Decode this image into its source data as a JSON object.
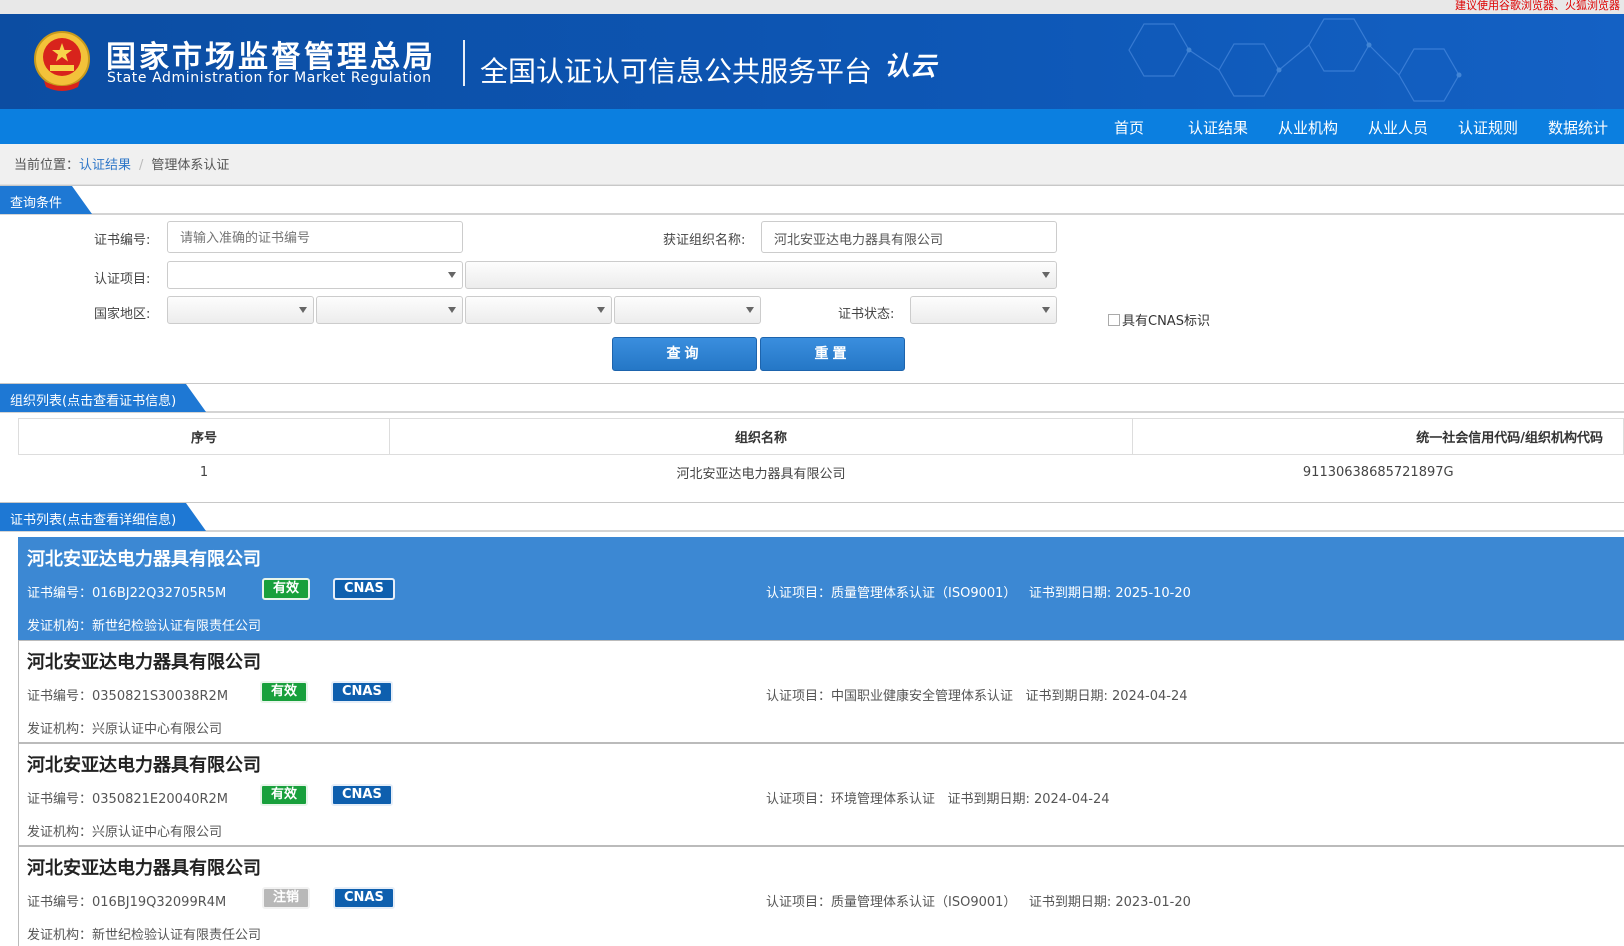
{
  "browser_notice": "建议使用谷歌浏览器、火狐浏览器",
  "header": {
    "org_cn": "国家市场监督管理总局",
    "org_en": "State Administration  for  Market Regulation",
    "platform": "全国认证认可信息公共服务平台",
    "brand": "认云"
  },
  "nav": [
    "首页",
    "认证结果",
    "从业机构",
    "从业人员",
    "认证规则",
    "数据统计"
  ],
  "breadcrumb": {
    "prefix": "当前位置：",
    "level1": "认证结果",
    "separator": "/",
    "level2": "管理体系认证"
  },
  "query": {
    "section_title": "查询条件",
    "cert_no_label": "证书编号:",
    "cert_no_placeholder": "请输入准确的证书编号",
    "org_name_label": "获证组织名称:",
    "org_name_value": "河北安亚达电力器具有限公司",
    "cert_item_label": "认证项目:",
    "region_label": "国家地区:",
    "status_label": "证书状态:",
    "cnas_label": "具有CNAS标识",
    "search_button": "查询",
    "reset_button": "重置"
  },
  "org_list": {
    "section_title": "组织列表(点击查看证书信息)",
    "columns": [
      "序号",
      "组织名称",
      "统一社会信用代码/组织机构代码"
    ],
    "rows": [
      [
        "1",
        "河北安亚达电力器具有限公司",
        "91130638685721897G"
      ]
    ]
  },
  "cert_list": {
    "section_title": "证书列表(点击查看详细信息)",
    "cert_no_prefix": "证书编号：",
    "issuer_prefix": "发证机构：",
    "item_prefix": "认证项目：",
    "expiry_prefix": "证书到期日期:",
    "cnas_badge": "CNAS",
    "items": [
      {
        "name": "河北安亚达电力器具有限公司",
        "cert_no": "016BJ22Q32705R5M",
        "status": "有效",
        "item": "质量管理体系认证（ISO9001）",
        "expiry": "2025-10-20",
        "issuer": "新世纪检验认证有限责任公司"
      },
      {
        "name": "河北安亚达电力器具有限公司",
        "cert_no": "0350821S30038R2M",
        "status": "有效",
        "item": "中国职业健康安全管理体系认证",
        "expiry": "2024-04-24",
        "issuer": "兴原认证中心有限公司"
      },
      {
        "name": "河北安亚达电力器具有限公司",
        "cert_no": "0350821E20040R2M",
        "status": "有效",
        "item": "环境管理体系认证",
        "expiry": "2024-04-24",
        "issuer": "兴原认证中心有限公司"
      },
      {
        "name": "河北安亚达电力器具有限公司",
        "cert_no": "016BJ19Q32099R4M",
        "status": "注销",
        "item": "质量管理体系认证（ISO9001）",
        "expiry": "2023-01-20",
        "issuer": "新世纪检验认证有限责任公司"
      }
    ]
  },
  "colors": {
    "header_blue": "#0d56b4",
    "nav_blue": "#0b7fe0",
    "tab_blue": "#1e78d4",
    "active_card": "#3c88d3",
    "valid_green": "#18a03c",
    "void_gray": "#b8b8b8",
    "cnas_blue": "#0e5fae"
  }
}
